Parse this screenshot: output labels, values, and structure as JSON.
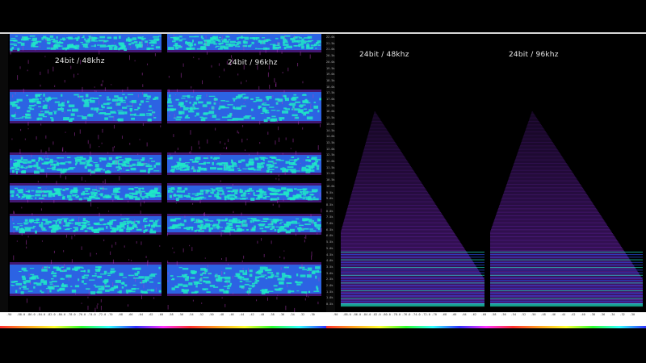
{
  "left_panel": {
    "label_a": "24bit / 48khz",
    "label_b": "24bit / 96khz",
    "colors": {
      "band_core": "#20e8c8",
      "band_mid": "#2a6cf0",
      "band_edge": "#7a2ad0",
      "spikes": "#c03cc8",
      "background": "#000000"
    }
  },
  "right_panel": {
    "label_a": "24bit / 48khz",
    "label_b": "24bit / 96khz",
    "y_ticks": [
      "22.0k",
      "21.5k",
      "21.0k",
      "20.5k",
      "20.0k",
      "19.5k",
      "19.0k",
      "18.5k",
      "18.0k",
      "17.5k",
      "17.0k",
      "16.5k",
      "16.0k",
      "15.5k",
      "15.0k",
      "14.5k",
      "14.0k",
      "13.5k",
      "13.0k",
      "12.5k",
      "12.0k",
      "11.5k",
      "11.0k",
      "10.5k",
      "10.0k",
      "9.5k",
      "9.0k",
      "8.5k",
      "8.0k",
      "7.5k",
      "7.0k",
      "6.5k",
      "6.0k",
      "5.5k",
      "5.0k",
      "4.5k",
      "4.0k",
      "3.5k",
      "3.0k",
      "2.5k",
      "2.0k",
      "1.5k",
      "1.0k",
      "0.5k"
    ],
    "colors": {
      "triangle": "#7a28c8",
      "low_lines": "#2a50f0",
      "floor": "#20e8c8"
    }
  },
  "x_ticks": [
    "-90",
    "-88.0",
    "-86.0",
    "-84.0",
    "-82.0",
    "-80.0",
    "-78.0",
    "-76.0",
    "-74.0",
    "-72.0",
    "-70",
    "-68",
    "-66",
    "-64",
    "-62",
    "-60",
    "-58",
    "-56",
    "-54",
    "-52",
    "-50",
    "-48",
    "-46",
    "-44",
    "-42",
    "-40",
    "-38",
    "-36",
    "-34",
    "-32",
    "-30"
  ]
}
